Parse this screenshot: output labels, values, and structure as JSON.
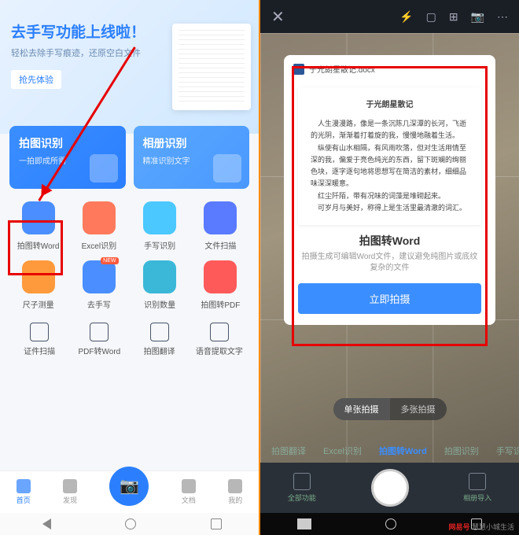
{
  "left": {
    "banner": {
      "title": "去手写功能上线啦！",
      "sub": "轻松去除手写痕迹，还原空白文件",
      "btn": "抢先体验"
    },
    "cards": [
      {
        "title": "拍图识别",
        "sub": "一拍即成所需"
      },
      {
        "title": "相册识别",
        "sub": "精准识别文字"
      }
    ],
    "grid1": [
      {
        "label": "拍图转Word",
        "color": "#4a8eff"
      },
      {
        "label": "Excel识别",
        "color": "#ff7a5c"
      },
      {
        "label": "手写识别",
        "color": "#4ac8ff"
      },
      {
        "label": "文件扫描",
        "color": "#5a7aff"
      }
    ],
    "grid2": [
      {
        "label": "尺子测量",
        "color": "#ff9a3c",
        "badge": ""
      },
      {
        "label": "去手写",
        "color": "#4a8eff",
        "badge": "NEW"
      },
      {
        "label": "识别数量",
        "color": "#3bb8d8"
      },
      {
        "label": "拍图转PDF",
        "color": "#ff5a5a"
      }
    ],
    "row4": [
      "证件扫描",
      "PDF转Word",
      "拍图翻译",
      "语音提取文字"
    ],
    "tabs": [
      "首页",
      "发现",
      "",
      "文档",
      "我的"
    ]
  },
  "right": {
    "filename": "于光朗星散记.docx",
    "docTitle": "于光朗星散记",
    "docBody": "　人生漫漫路，像是一条沉陈几深潭的长河，飞逝的光阴，渐渐着打着旋的我，慢慢地融着生活。\n　纵使有山水相隔，有风雨吹落，但对生活用情至深的我，偏爱于亮色纯光的东西，留下斑斓的绚丽色块，逐字逐句地将思想写在简洁的素材，细细品味深深暖意。\n　红尘阡陌，带有况味的词藻是堆砌起来。\n　可岁月与美好，称得上是生活里最清澈的词汇。",
    "popTitle": "拍图转Word",
    "popSub": "拍摄生成可编辑Word文件，建议避免纯图片或底纹复杂的文件",
    "popBtn": "立即拍摄",
    "modes": [
      "单张拍摄",
      "多张拍摄"
    ],
    "strip": [
      "拍图翻译",
      "Excel识别",
      "拍图转Word",
      "拍图识别",
      "手写识别"
    ],
    "bar": [
      "全部功能",
      "",
      "相册导入"
    ]
  },
  "watermark": {
    "brand": "网易号",
    "author": "慧慧小城生活"
  }
}
